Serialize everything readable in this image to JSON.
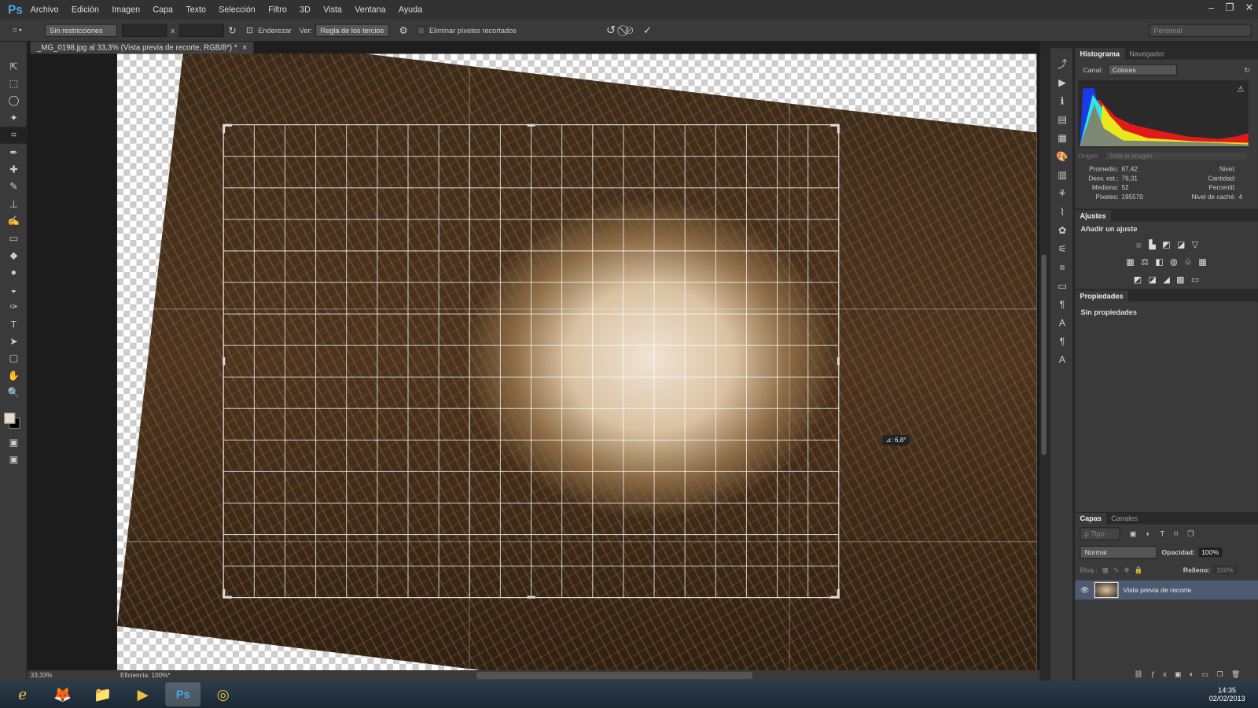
{
  "app": {
    "logo": "Ps",
    "menu": [
      "Archivo",
      "Edición",
      "Imagen",
      "Capa",
      "Texto",
      "Selección",
      "Filtro",
      "3D",
      "Vista",
      "Ventana",
      "Ayuda"
    ],
    "window_controls": [
      "–",
      "❐",
      "✕"
    ]
  },
  "options": {
    "ratio": "Sin restricciones",
    "x_sep": "x",
    "straighten": "Enderezar",
    "view_label": "Ver:",
    "view": "Regla de los tercios",
    "delete_pixels": "Eliminar píxeles recortados",
    "workspace": "Personal"
  },
  "document": {
    "tab": "_MG_0198.jpg al 33,3% (Vista previa de recorte, RGB/8*) *",
    "close": "×",
    "angle": "⊿: 6,8°",
    "zoom": "33,33%",
    "efficiency": "Eficiencia: 100%*"
  },
  "histogram": {
    "tabs": [
      "Histograma",
      "Navegador"
    ],
    "channel_label": "Canal:",
    "channel": "Colores",
    "source_label": "Origen:",
    "source": "Toda la imagen",
    "stats_left": [
      [
        "Promedio:",
        "87,42"
      ],
      [
        "Desv. est.:",
        "79,31"
      ],
      [
        "Mediana:",
        "52"
      ],
      [
        "Píxeles:",
        "195570"
      ]
    ],
    "stats_right": [
      [
        "Nivel:",
        ""
      ],
      [
        "Cantidad:",
        ""
      ],
      [
        "Percentil:",
        ""
      ],
      [
        "Nivel de caché:",
        "4"
      ]
    ]
  },
  "adjustments": {
    "tab": "Ajustes",
    "title": "Añadir un ajuste"
  },
  "properties": {
    "tab": "Propiedades",
    "text": "Sin propiedades"
  },
  "layers": {
    "tabs": [
      "Capas",
      "Canales"
    ],
    "filter": "ρ Tipo",
    "blend": "Normal",
    "opacity_label": "Opacidad:",
    "opacity": "100%",
    "lock_label": "Bloq.:",
    "fill_label": "Relleno:",
    "fill": "100%",
    "layer_name": "Vista previa de recorte"
  },
  "taskbar": {
    "time": "14:35",
    "date": "02/02/2013",
    "apps": [
      "ie",
      "firefox",
      "explorer",
      "media-player",
      "photoshop",
      "app"
    ]
  }
}
